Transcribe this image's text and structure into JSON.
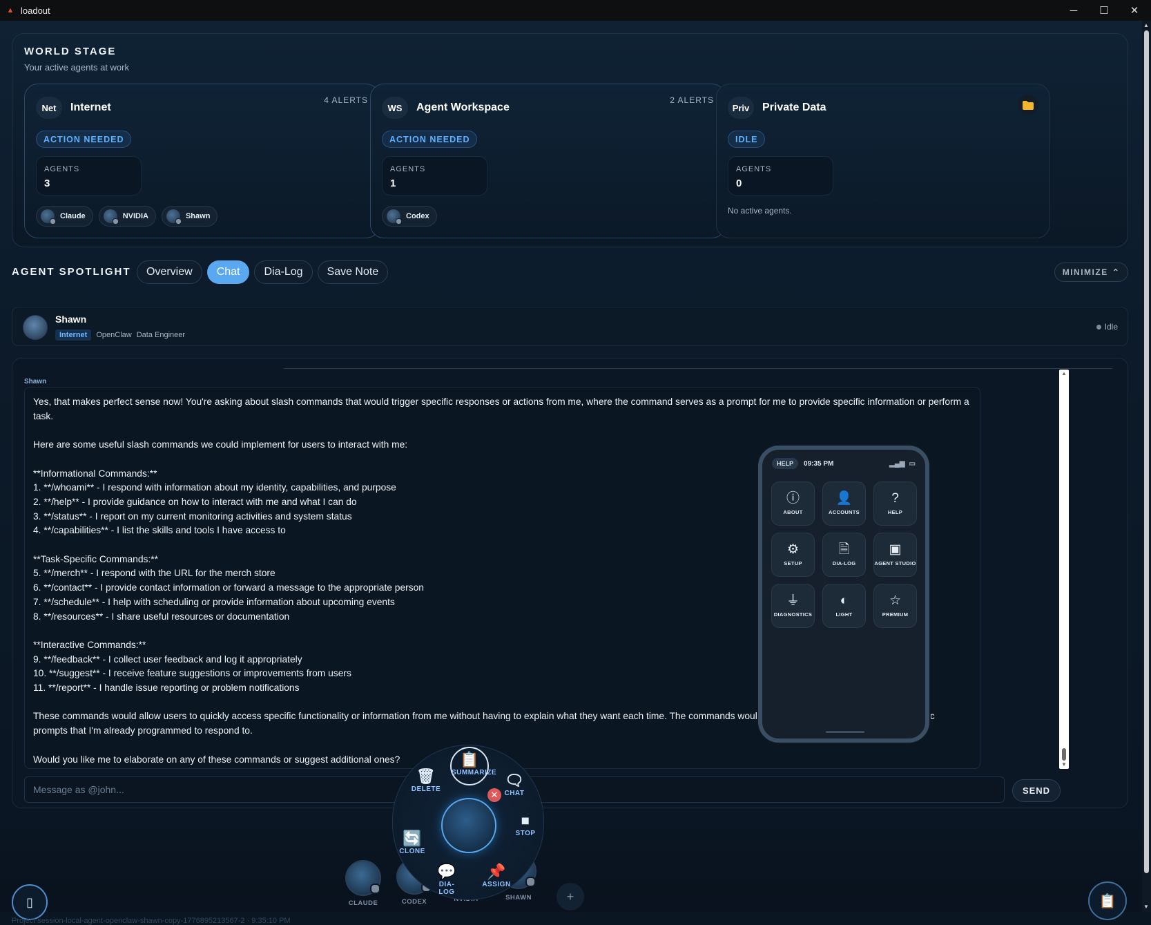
{
  "window": {
    "title": "loadout",
    "minimize_glyph": "─",
    "maximize_glyph": "☐",
    "close_glyph": "✕"
  },
  "world_stage": {
    "title": "WORLD STAGE",
    "subtitle": "Your active agents at work",
    "cards": [
      {
        "abbr": "Net",
        "name": "Internet",
        "alerts": "4 ALERTS",
        "status": "ACTION NEEDED",
        "agents_label": "AGENTS",
        "agents_count": "3",
        "agents": [
          "Claude",
          "NVIDIA",
          "Shawn"
        ]
      },
      {
        "abbr": "WS",
        "name": "Agent Workspace",
        "alerts": "2 ALERTS",
        "status": "ACTION NEEDED",
        "agents_label": "AGENTS",
        "agents_count": "1",
        "agents": [
          "Codex"
        ]
      },
      {
        "abbr": "Priv",
        "name": "Private Data",
        "status": "IDLE",
        "agents_label": "AGENTS",
        "agents_count": "0",
        "empty_text": "No active agents.",
        "icon": "folder-icon"
      }
    ]
  },
  "spotlight": {
    "title": "AGENT SPOTLIGHT",
    "tabs": [
      "Overview",
      "Chat",
      "Dia-Log",
      "Save Note"
    ],
    "active_tab": "Chat",
    "minimize_label": "MINIMIZE",
    "agent": {
      "name": "Shawn",
      "network": "Internet",
      "framework": "OpenClaw",
      "role": "Data Engineer",
      "state": "Idle"
    }
  },
  "chat": {
    "sender": "Shawn",
    "message": "Yes, that makes perfect sense now! You're asking about slash commands that would trigger specific responses or actions from me, where the command serves as a prompt for me to provide specific information or perform a task.\n\nHere are some useful slash commands we could implement for users to interact with me:\n\n**Informational Commands:**\n1. **/whoami** - I respond with information about my identity, capabilities, and purpose\n2. **/help** - I provide guidance on how to interact with me and what I can do\n3. **/status** - I report on my current monitoring activities and system status\n4. **/capabilities** - I list the skills and tools I have access to\n\n**Task-Specific Commands:**\n5. **/merch** - I respond with the URL for the merch store\n6. **/contact** - I provide contact information or forward a message to the appropriate person\n7. **/schedule** - I help with scheduling or provide information about upcoming events\n8. **/resources** - I share useful resources or documentation\n\n**Interactive Commands:**\n9. **/feedback** - I collect user feedback and log it appropriately\n10. **/suggest** - I receive feature suggestions or improvements from users\n11. **/report** - I handle issue reporting or problem notifications\n\nThese commands would allow users to quickly access specific functionality or information from me without having to explain what they want each time. The commands would essentially serve as shortcuts to specific prompts that I'm already programmed to respond to.\n\nWould you like me to elaborate on any of these commands or suggest additional ones?",
    "input_placeholder": "Message as @john...",
    "send_label": "SEND"
  },
  "phone": {
    "help_label": "HELP",
    "time": "09:35 PM",
    "buttons": [
      {
        "label": "ABOUT",
        "icon": "info-icon",
        "glyph": "ⓘ"
      },
      {
        "label": "ACCOUNTS",
        "icon": "user-icon",
        "glyph": "👤"
      },
      {
        "label": "HELP",
        "icon": "question-icon",
        "glyph": "?"
      },
      {
        "label": "SETUP",
        "icon": "gear-icon",
        "glyph": "⚙"
      },
      {
        "label": "DIA-LOG",
        "icon": "document-icon",
        "glyph": "🗎"
      },
      {
        "label": "AGENT STUDIO",
        "icon": "chip-icon",
        "glyph": "▣"
      },
      {
        "label": "DIAGNOSTICS",
        "icon": "plug-icon",
        "glyph": "⏚"
      },
      {
        "label": "LIGHT",
        "icon": "theme-icon",
        "glyph": "◐"
      },
      {
        "label": "PREMIUM",
        "icon": "star-icon",
        "glyph": "☆"
      }
    ]
  },
  "radial_menu": {
    "summarize": "SUMMARIZE",
    "delete": "DELETE",
    "chat": "CHAT",
    "stop": "STOP",
    "clone": "CLONE",
    "dialog": "DIA-\nLOG",
    "assign": "ASSIGN"
  },
  "dock": {
    "agents": [
      "CLAUDE",
      "CODEX",
      "NVIDIA",
      "SHAWN"
    ],
    "add_glyph": "+",
    "session_text": "Project session-local-agent-openclaw-shawn-copy-1776895213567-2 · 9:35:10 PM"
  },
  "colors": {
    "accent": "#5aa8ef",
    "status_blue": "#5fb0ff",
    "close_red": "#e05a5a",
    "background": "#0b1623"
  }
}
